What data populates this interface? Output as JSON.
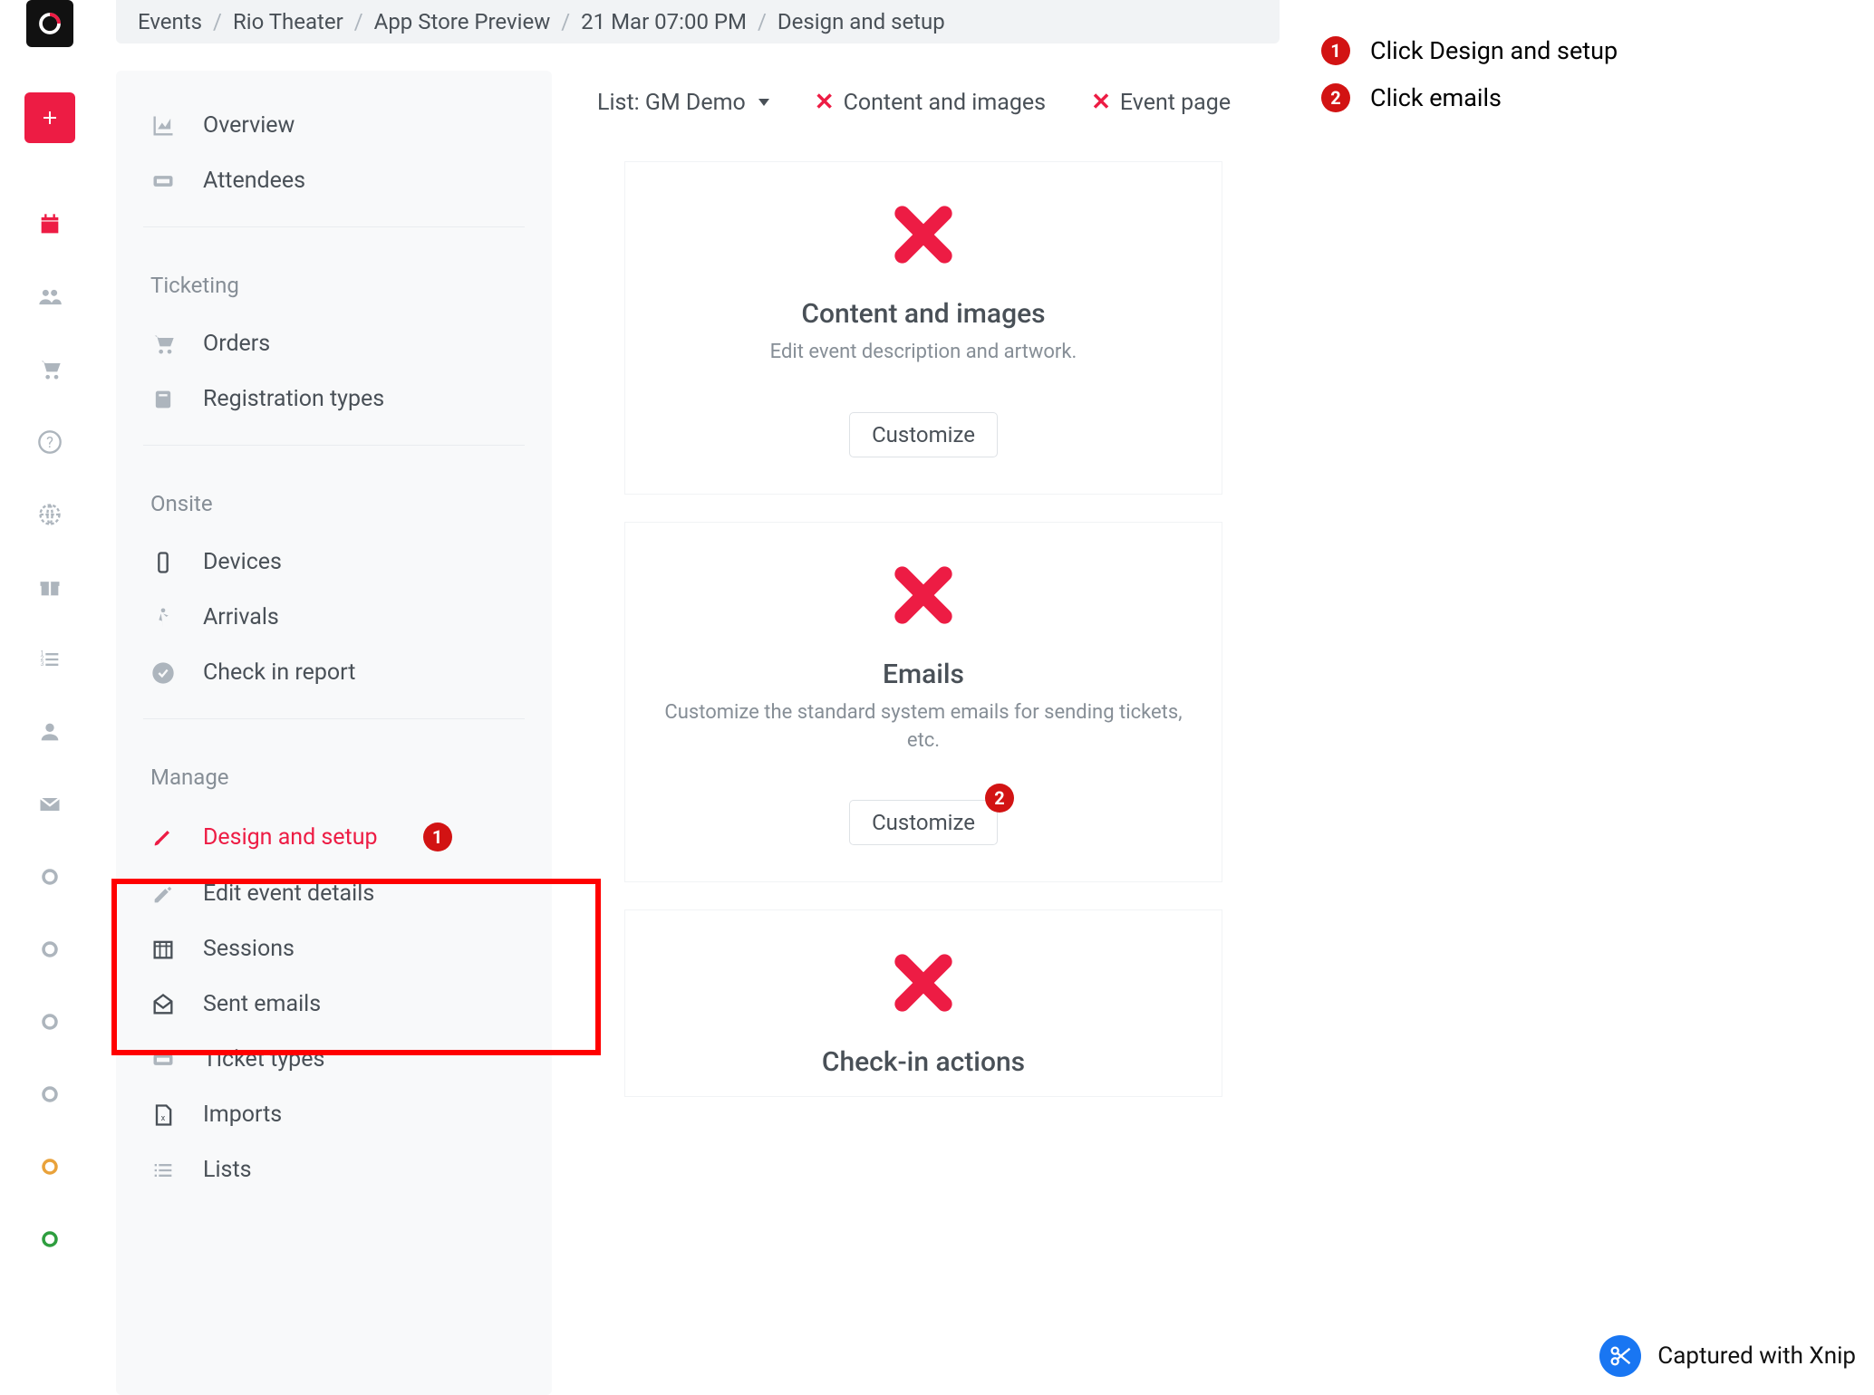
{
  "breadcrumb": [
    "Events",
    "Rio Theater",
    "App Store Preview",
    "21 Mar 07:00 PM",
    "Design and setup"
  ],
  "sidebar": {
    "top": [
      {
        "label": "Overview"
      },
      {
        "label": "Attendees"
      }
    ],
    "ticketing_heading": "Ticketing",
    "ticketing": [
      {
        "label": "Orders"
      },
      {
        "label": "Registration types"
      }
    ],
    "onsite_heading": "Onsite",
    "onsite": [
      {
        "label": "Devices"
      },
      {
        "label": "Arrivals"
      },
      {
        "label": "Check in report"
      }
    ],
    "manage_heading": "Manage",
    "manage": [
      {
        "label": "Design and setup"
      },
      {
        "label": "Edit event details"
      },
      {
        "label": "Sessions"
      },
      {
        "label": "Sent emails"
      },
      {
        "label": "Ticket types"
      },
      {
        "label": "Imports"
      },
      {
        "label": "Lists"
      }
    ]
  },
  "content_header": {
    "list_label": "List: GM Demo",
    "content_images": "Content and images",
    "event_page": "Event page"
  },
  "cards": [
    {
      "title": "Content and images",
      "desc": "Edit event description and artwork.",
      "button": "Customize"
    },
    {
      "title": "Emails",
      "desc": "Customize the standard system emails for sending tickets, etc.",
      "button": "Customize"
    },
    {
      "title": "Check-in actions",
      "desc": "",
      "button": ""
    }
  ],
  "instructions": [
    "Click Design and setup",
    "Click emails"
  ],
  "captured": "Captured with Xnip"
}
